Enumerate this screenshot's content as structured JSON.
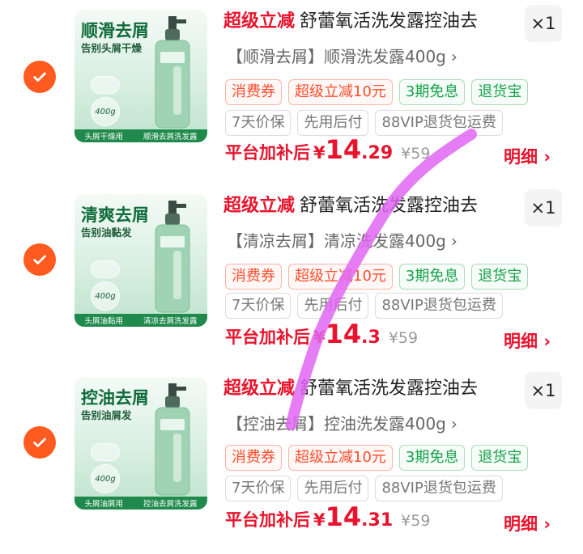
{
  "colors": {
    "accent": "#ff5a1f",
    "price_red": "#e8142d",
    "tag_green": "#17a34a"
  },
  "items": [
    {
      "checked": true,
      "image": {
        "title": "顺滑去屑",
        "subtitle": "告别头屑干燥",
        "labels": [
          "头屑干燥用",
          "顺滑去屑洗发露"
        ],
        "volume": "400g"
      },
      "promo": "超级立减",
      "name": "舒蕾氧活洗发露控油去",
      "quantity": "×1",
      "spec": "【顺滑去屑】顺滑洗发露400g",
      "tags_row1": [
        "消费券",
        "超级立减10元",
        "3期免息",
        "退货宝"
      ],
      "tags_row2": [
        "7天价保",
        "先用后付",
        "88VIP退货包运费"
      ],
      "price_label": "平台加补后",
      "currency": "¥",
      "price_int": "14",
      "price_dec": ".29",
      "original_price": "¥59",
      "detail": "明细"
    },
    {
      "checked": true,
      "image": {
        "title": "清爽去屑",
        "subtitle": "告别油黏发",
        "labels": [
          "头屑油黏用",
          "清凉去屑洗发露"
        ],
        "volume": "400g"
      },
      "promo": "超级立减",
      "name": "舒蕾氧活洗发露控油去",
      "quantity": "×1",
      "spec": "【清凉去屑】清凉洗发露400g",
      "tags_row1": [
        "消费券",
        "超级立减10元",
        "3期免息",
        "退货宝"
      ],
      "tags_row2": [
        "7天价保",
        "先用后付",
        "88VIP退货包运费"
      ],
      "price_label": "平台加补后",
      "currency": "¥",
      "price_int": "14",
      "price_dec": ".3",
      "original_price": "¥59",
      "detail": "明细"
    },
    {
      "checked": true,
      "image": {
        "title": "控油去屑",
        "subtitle": "告别油屑发",
        "labels": [
          "头屑油屑用",
          "控油去屑洗发露"
        ],
        "volume": "400g"
      },
      "promo": "超级立减",
      "name": "舒蕾氧活洗发露控油去",
      "quantity": "×1",
      "spec": "【控油去屑】控油洗发露400g",
      "tags_row1": [
        "消费券",
        "超级立减10元",
        "3期免息",
        "退货宝"
      ],
      "tags_row2": [
        "7天价保",
        "先用后付",
        "88VIP退货包运费"
      ],
      "price_label": "平台加补后",
      "currency": "¥",
      "price_int": "14",
      "price_dec": ".31",
      "original_price": "¥59",
      "detail": "明细"
    }
  ]
}
